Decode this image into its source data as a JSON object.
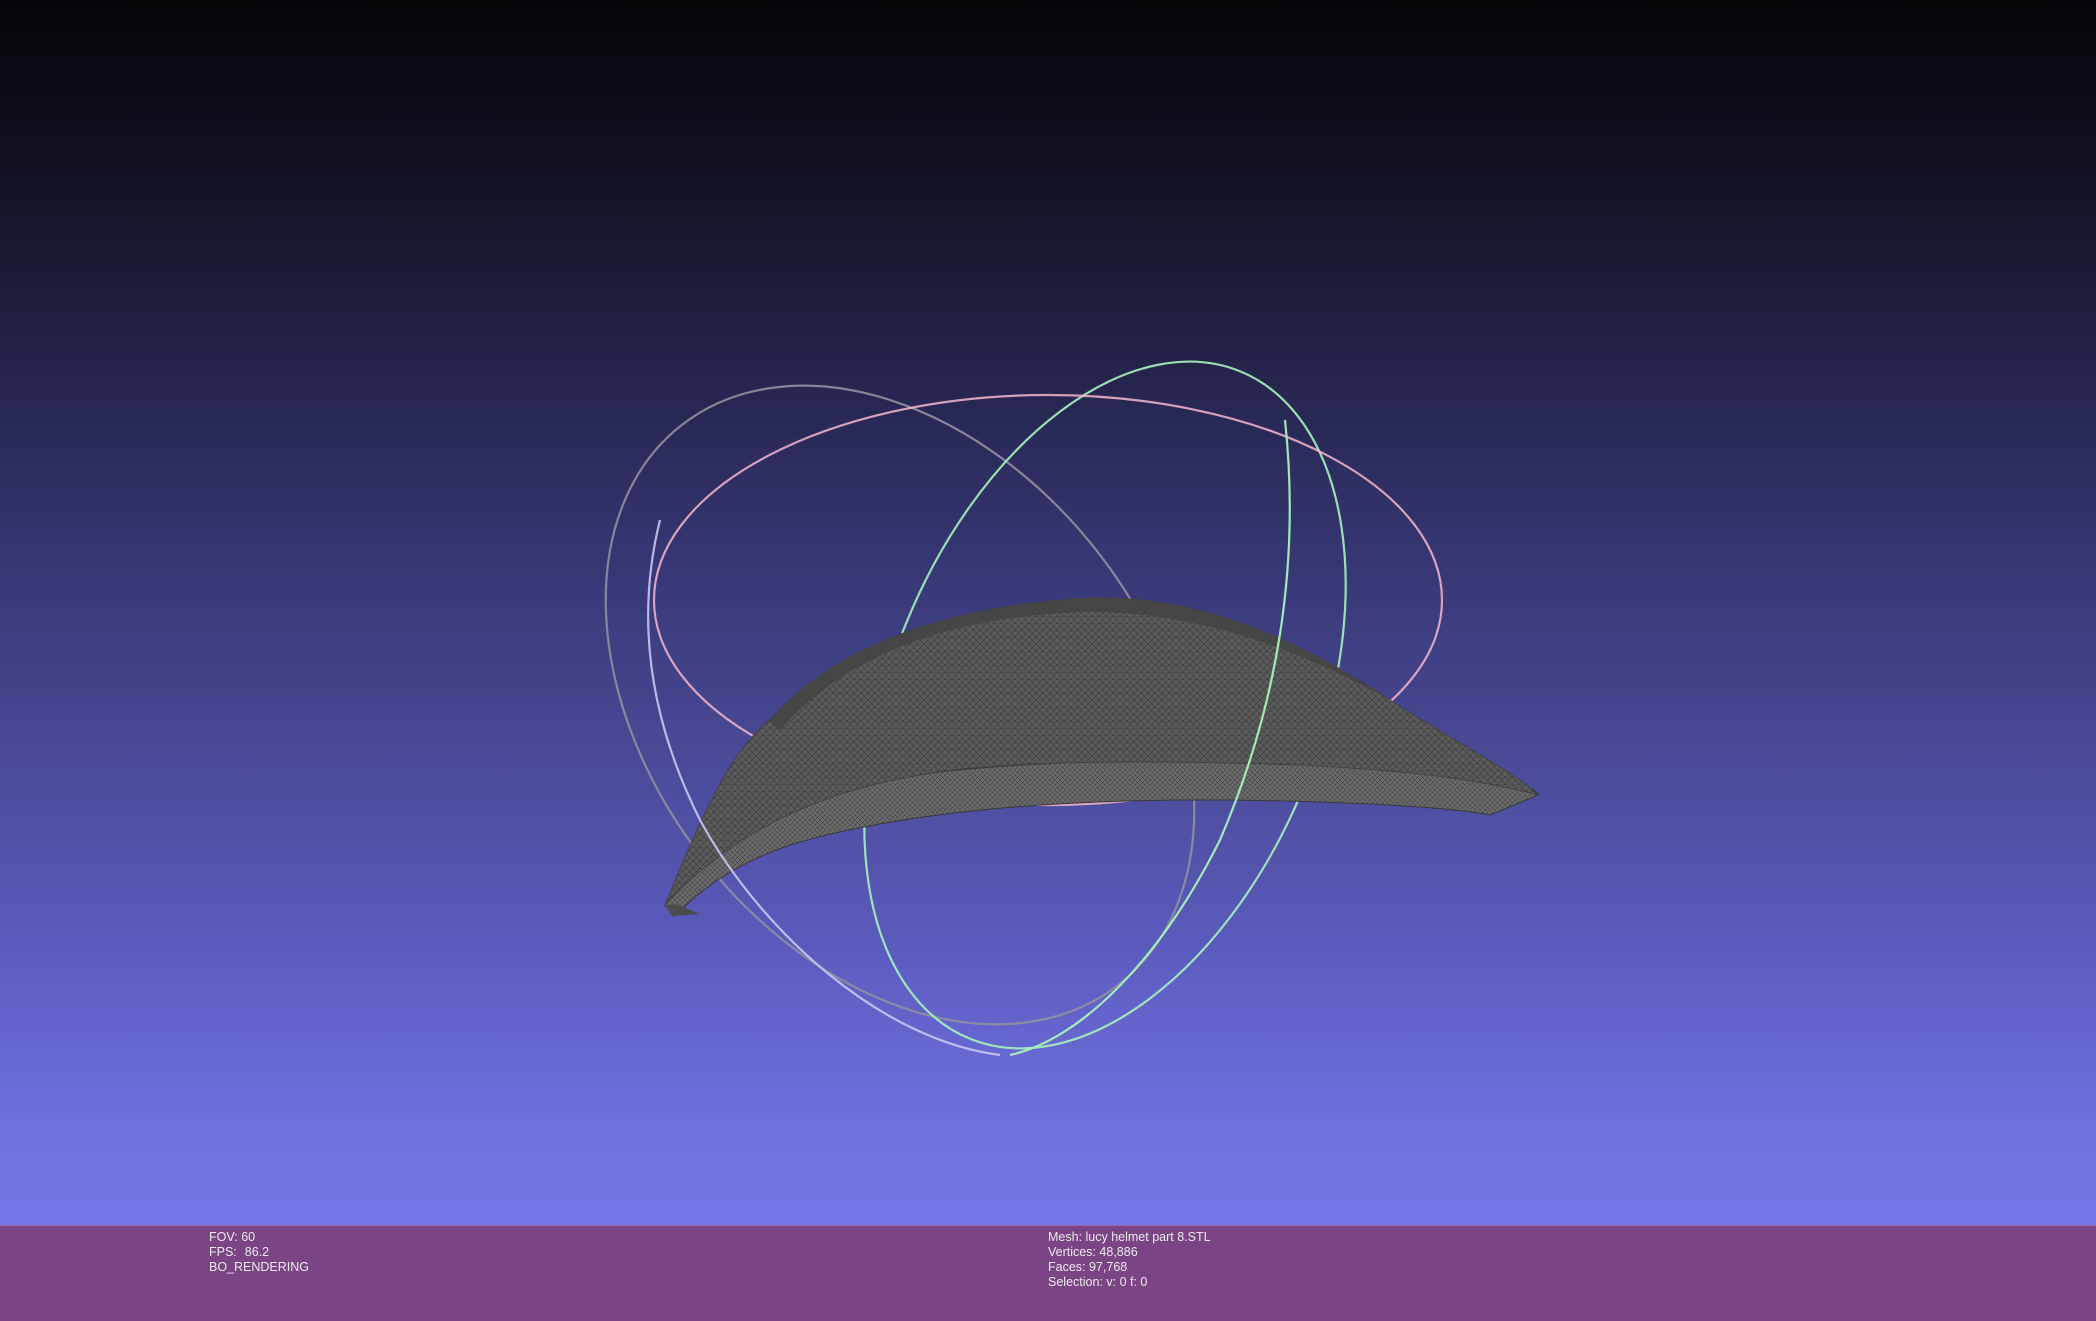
{
  "viewport": {
    "background_top": "#050508",
    "background_bottom": "#7676e8",
    "trackball": {
      "ring_x_color": "#c6c6f2",
      "ring_y_color": "#a6f2bc",
      "ring_z_color": "#f4b6cd",
      "ring_inactive_color": "#8f8f9f"
    },
    "mesh_color": "#5a5a5a"
  },
  "info_left": {
    "fov_label": "FOV:",
    "fov_value": "60",
    "fps_label": "FPS:",
    "fps_value": "86.2",
    "render_mode": "BO_RENDERING"
  },
  "info_right": {
    "mesh_line": "Mesh: lucy helmet part 8.STL",
    "vertices_line": "Vertices: 48,886",
    "faces_line": "Faces: 97,768",
    "selection_line": "Selection: v: 0 f: 0"
  },
  "info_bar_color": "#7b4585"
}
